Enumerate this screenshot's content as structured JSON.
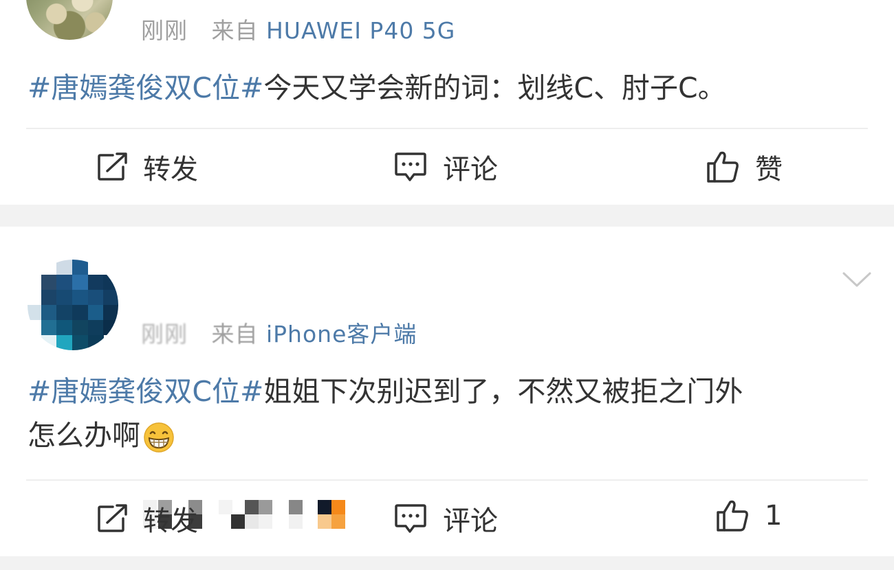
{
  "posts": [
    {
      "time": "刚刚",
      "from_prefix": "来自",
      "source": "HUAWEI P40 5G",
      "hashtag": "#唐嫣龚俊双C位#",
      "text": "今天又学会新的词：划线C、肘子C。",
      "actions": {
        "forward": "转发",
        "comment": "评论",
        "like": "赞"
      }
    },
    {
      "time": "刚刚",
      "from_prefix": "来自",
      "source": "iPhone客户端",
      "hashtag": "#唐嫣龚俊双C位#",
      "text_line1": "姐姐下次别迟到了，不然又被拒之门外",
      "text_line2": "怎么办啊",
      "emoji": "grinning-face",
      "actions": {
        "forward": "转发",
        "comment": "评论",
        "like": "1"
      }
    }
  ],
  "colors": {
    "link": "#4d7aa8",
    "meta": "#a0a0a0",
    "text": "#333333",
    "separator": "#f2f2f2"
  }
}
